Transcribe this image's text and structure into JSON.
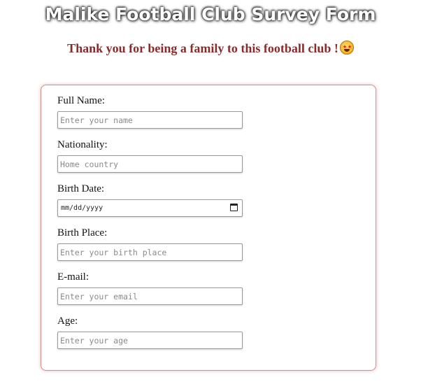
{
  "header": {
    "title": "Malike Football Club Survey Form",
    "subtitle": "Thank you for being a family to this football club !",
    "emoji": "star-struck-emoji"
  },
  "colors": {
    "subtitle": "#8b2a2a",
    "card_border": "#d98f8f"
  },
  "form": {
    "full_name": {
      "label": "Full Name:",
      "placeholder": "Enter your name"
    },
    "nationality": {
      "label": "Nationality:",
      "placeholder": "Home country"
    },
    "birth_date": {
      "label": "Birth Date:",
      "value": "mm/dd/yyyy",
      "icon": "calendar-icon"
    },
    "birth_place": {
      "label": "Birth Place:",
      "placeholder": "Enter your birth place"
    },
    "email": {
      "label": "E-mail:",
      "placeholder": "Enter your email"
    },
    "age": {
      "label": "Age:",
      "placeholder": "Enter your age"
    }
  }
}
